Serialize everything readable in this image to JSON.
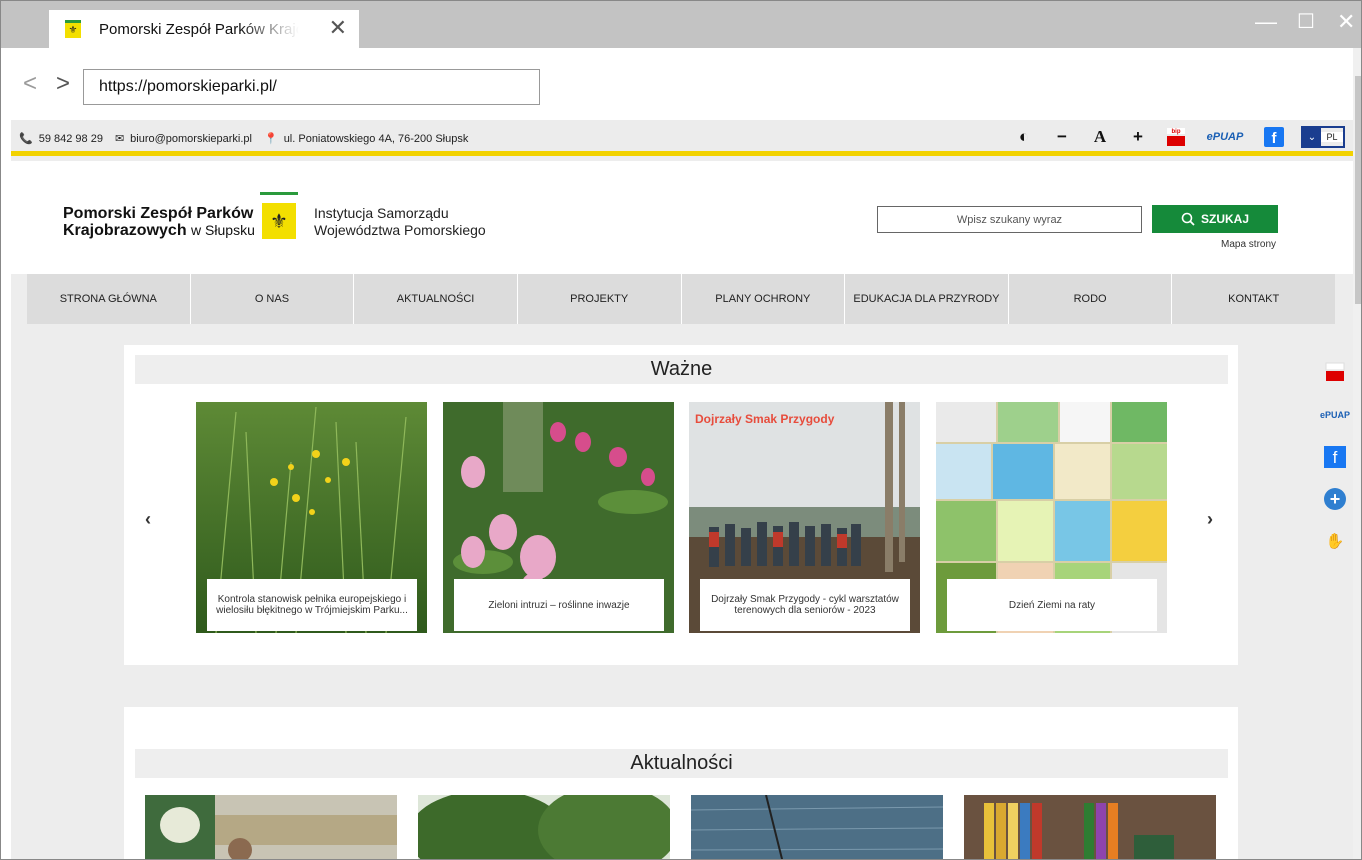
{
  "browser": {
    "tab_title": "Pomorski Zespół Parków Krajobrazowych",
    "url": "https://pomorskieparki.pl/"
  },
  "contact": {
    "phone": "59 842 98 29",
    "email": "biuro@pomorskieparki.pl",
    "address": "ul. Poniatowskiego 4A, 76-200 Słupsk"
  },
  "toolbar": {
    "contrast_icon": "contrast-icon",
    "font_smaller": "−",
    "font_normal": "A",
    "font_larger": "+",
    "bip_label": "bip",
    "epuap_label": "ePUAP",
    "lang": "PL"
  },
  "header": {
    "logo_line1": "Pomorski Zespół Parków",
    "logo_line2": "Krajobrazowych",
    "logo_line2_suffix": "w Słupsku",
    "inst_line1": "Instytucja Samorządu",
    "inst_line2": "Województwa Pomorskiego",
    "search_placeholder": "Wpisz szukany wyraz",
    "search_button": "SZUKAJ",
    "sitemap": "Mapa strony"
  },
  "menu": [
    "STRONA GŁÓWNA",
    "O NAS",
    "AKTUALNOŚCI",
    "PROJEKTY",
    "PLANY OCHRONY",
    "EDUKACJA DLA PRZYRODY",
    "RODO",
    "KONTAKT"
  ],
  "wazne": {
    "title": "Ważne",
    "cards": [
      {
        "caption": "Kontrola stanowisk pełnika europejskiego i wielosiłu błękitnego w Trójmiejskim Parku..."
      },
      {
        "caption": "Zieloni intruzi – roślinne inwazje"
      },
      {
        "caption": "Dojrzały Smak Przygody - cykl warsztatów terenowych dla seniorów - 2023",
        "overlay": "Dojrzały Smak Przygody"
      },
      {
        "caption": "Dzień Ziemi na raty"
      }
    ]
  },
  "aktualnosci": {
    "title": "Aktualności"
  }
}
